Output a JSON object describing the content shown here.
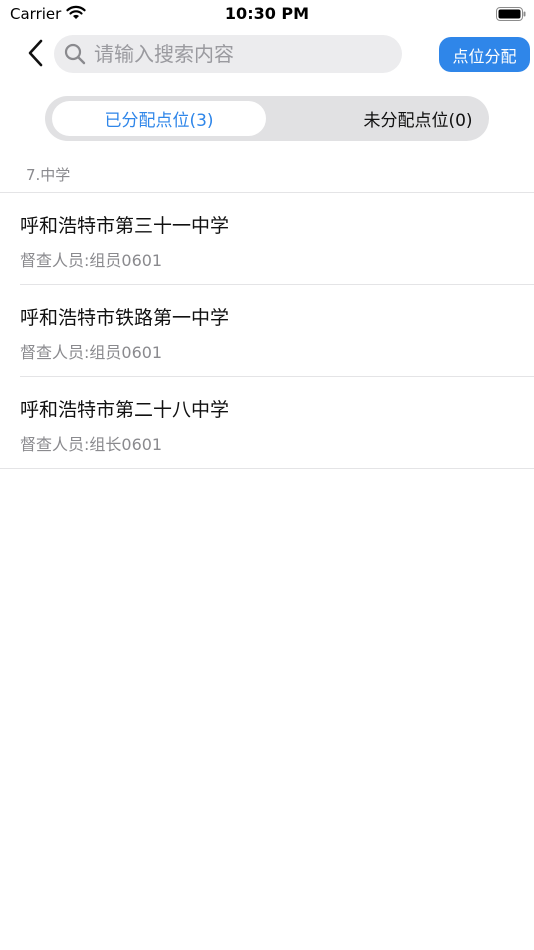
{
  "status_bar": {
    "carrier": "Carrier",
    "time": "10:30 PM"
  },
  "nav": {
    "back_icon": "chevron-left-icon",
    "search": {
      "icon": "search-icon",
      "placeholder": "请输入搜索内容",
      "value": ""
    },
    "assign_button_label": "点位分配"
  },
  "segment": {
    "tabs": [
      {
        "label": "已分配点位(3)",
        "selected": true
      },
      {
        "label": "未分配点位(0)",
        "selected": false
      }
    ]
  },
  "list": {
    "section_header": "7.中学",
    "items": [
      {
        "title": "呼和浩特市第三十一中学",
        "subtitle": "督查人员:组员0601"
      },
      {
        "title": "呼和浩特市铁路第一中学",
        "subtitle": "督查人员:组员0601"
      },
      {
        "title": "呼和浩特市第二十八中学",
        "subtitle": "督查人员:组长0601"
      }
    ]
  },
  "colors": {
    "accent": "#2f86e9",
    "segment_bg": "#e1e1e3",
    "search_bg": "#ececee",
    "secondary_text": "#8a8a8e"
  }
}
